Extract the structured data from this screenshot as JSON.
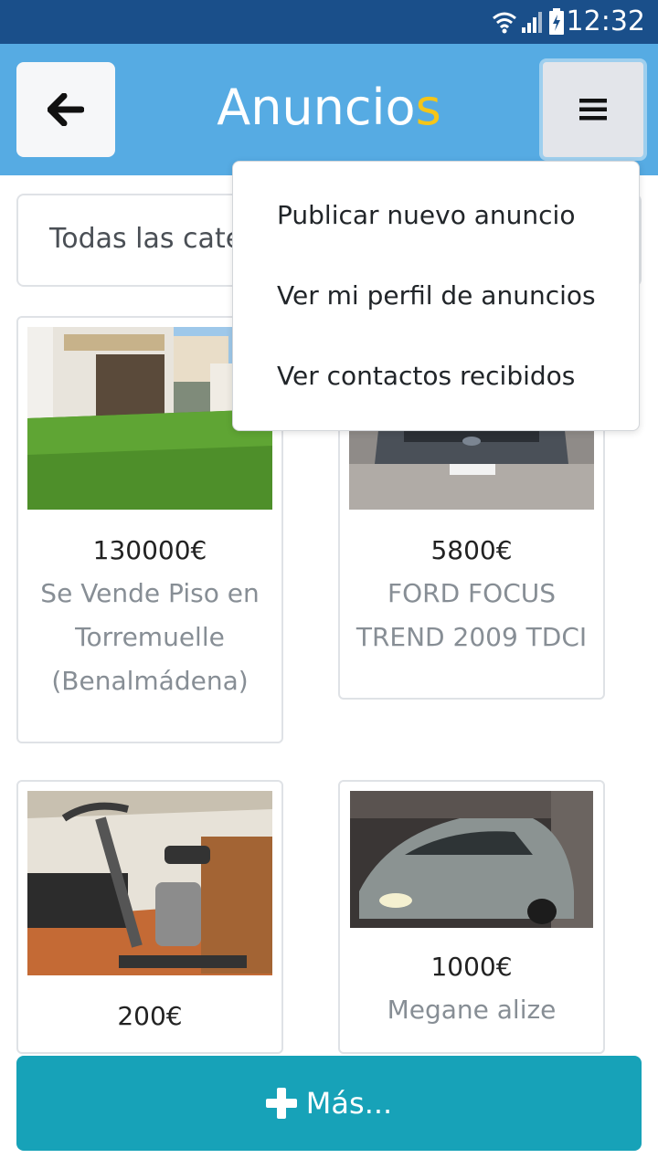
{
  "status_bar": {
    "time": "12:32"
  },
  "header": {
    "title_main": "Anuncio",
    "title_accent": "s"
  },
  "filter": {
    "category": "Todas las categorías"
  },
  "menu": {
    "items": [
      {
        "label": "Publicar nuevo anuncio"
      },
      {
        "label": "Ver mi perfil de anuncios"
      },
      {
        "label": "Ver contactos recibidos"
      }
    ]
  },
  "listings": [
    {
      "price": "130000€",
      "title": "Se Vende Piso en Torremuelle (Benalmádena)"
    },
    {
      "price": "5800€",
      "title": "FORD FOCUS TREND 2009 TDCI"
    },
    {
      "price": "200€",
      "title": ""
    },
    {
      "price": "1000€",
      "title": "Megane alize"
    }
  ],
  "footer": {
    "more_label": "Más..."
  },
  "colors": {
    "header": "#56abe3",
    "status_bar": "#1a4f8a",
    "accent": "#f5c518",
    "button": "#17a2b8"
  }
}
